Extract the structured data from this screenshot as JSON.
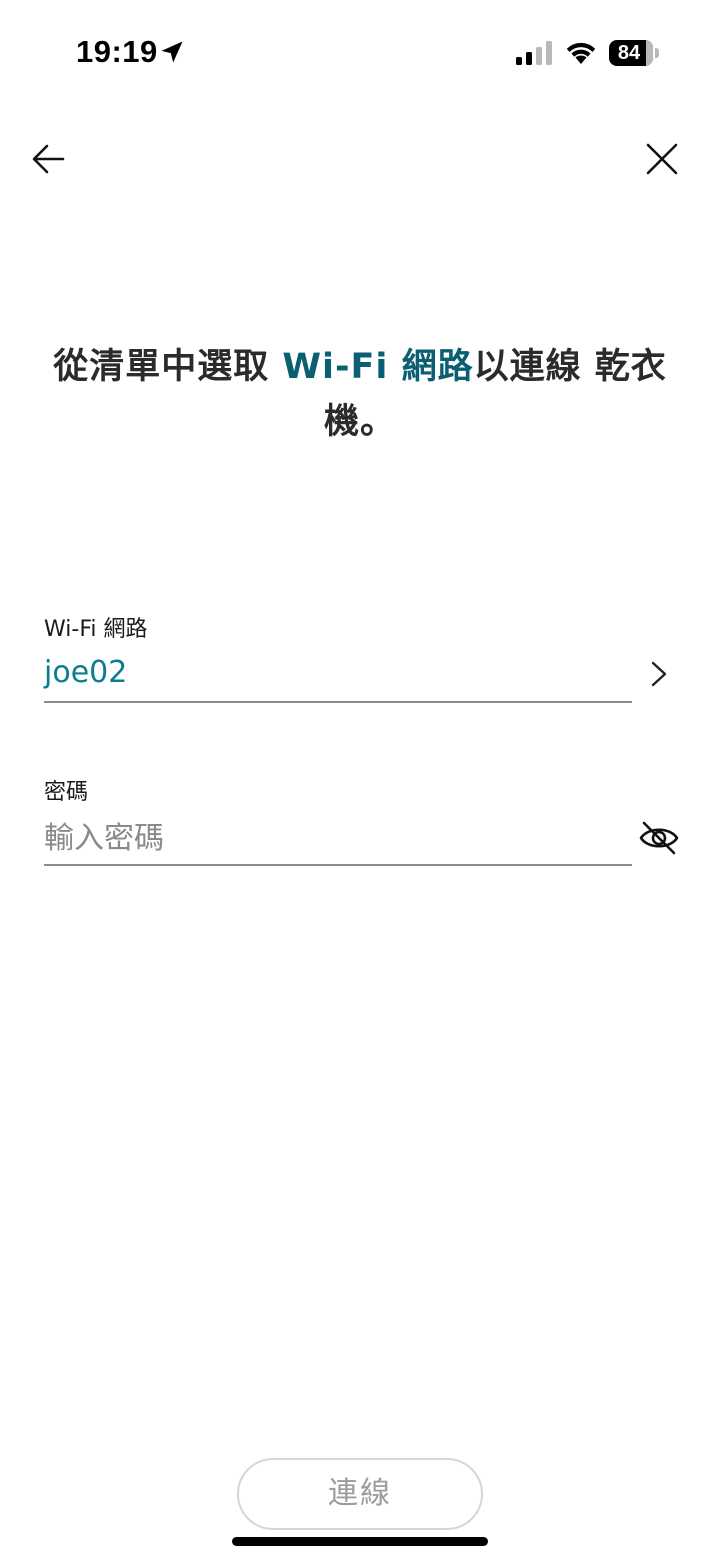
{
  "status_bar": {
    "time": "19:19",
    "battery_level": "84",
    "battery_fraction": 0.84,
    "icons": [
      "location-arrow-icon",
      "cellular-signal-icon",
      "wifi-icon",
      "battery-icon"
    ]
  },
  "nav": {
    "back_icon": "arrow-left-icon",
    "close_icon": "close-icon"
  },
  "heading": {
    "part1": "從清單中選取 ",
    "accent": "Wi-Fi 網路",
    "part2": "以連線 乾衣機。"
  },
  "colors": {
    "accent": "#0b5f73",
    "link_value": "#0b7d93",
    "disabled_text": "#9c9c9c"
  },
  "wifi_field": {
    "label": "Wi-Fi 網路",
    "value": "joe02",
    "icon": "chevron-right-icon"
  },
  "password_field": {
    "label": "密碼",
    "value": "",
    "placeholder": "輸入密碼",
    "icon": "eye-slash-icon"
  },
  "connect_button": {
    "label": "連線",
    "enabled": false
  }
}
